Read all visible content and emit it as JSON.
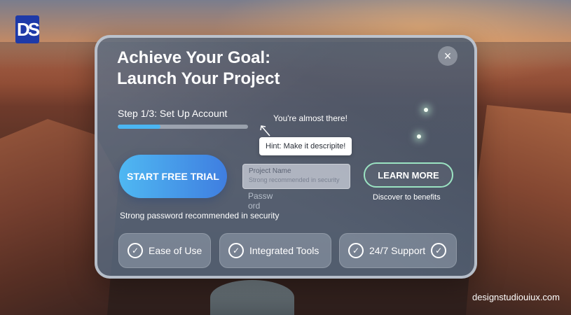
{
  "brand": {
    "logo_text": "DS",
    "watermark": "designstudiouiux.com"
  },
  "modal": {
    "title_line1": "Achieve Your Goal:",
    "title_line2": "Launch Your Project",
    "close_icon": "×",
    "step_label": "Step 1/3: Set Up Account",
    "progress_fraction": 0.33,
    "almost_text": "You're almost there!",
    "hint_text": "Hint: Make it descripite!",
    "trial_button": "START FREE TRIAL",
    "project_field": {
      "label": "Project Name",
      "placeholder": "Strong recommended in security"
    },
    "password_label": "Passw ord",
    "password_message": "Strong password recommended in security",
    "learn_button": "LEARN MORE",
    "discover_text": "Discover to benefits",
    "features": [
      {
        "label": "Ease of Use",
        "icon": "check-circle-icon"
      },
      {
        "label": "Integrated Tools",
        "icon": "check-circle-icon"
      },
      {
        "label": "24/7 Support",
        "icon": "check-circle-icon"
      }
    ]
  },
  "colors": {
    "accent_blue": "#4bb6f2",
    "learn_border": "#9be3c2"
  }
}
